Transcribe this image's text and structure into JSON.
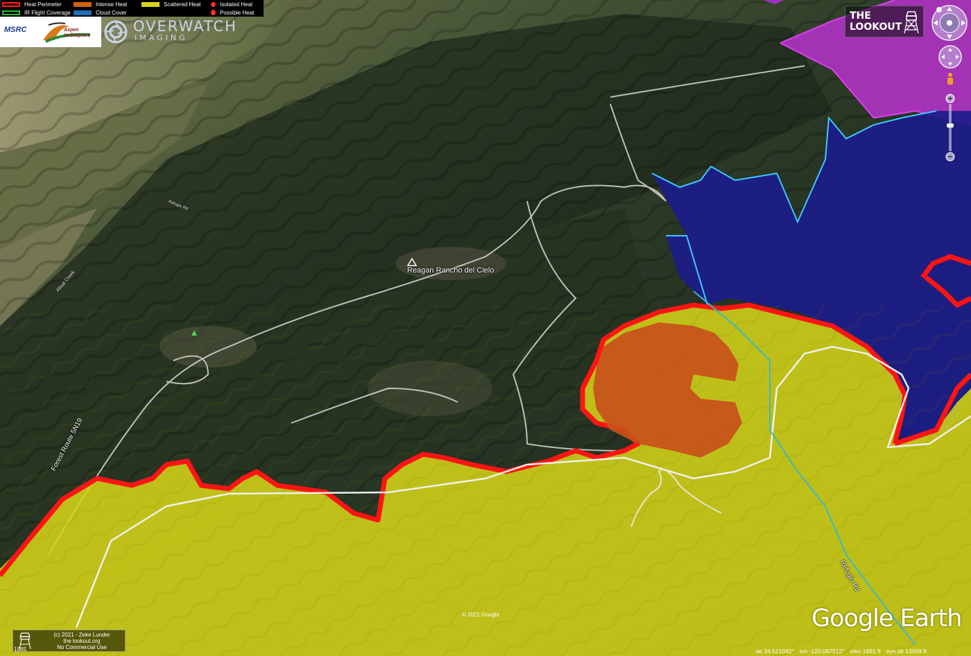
{
  "legend": {
    "items": [
      {
        "label": "Heat Perimeter",
        "kind": "outline",
        "color": "#ff1a1a"
      },
      {
        "label": "IR Flight Coverage",
        "kind": "outline",
        "color": "#1fbf3a"
      },
      {
        "label": "Intense Heat",
        "kind": "fill",
        "color": "#d4600f"
      },
      {
        "label": "Cloud Cover",
        "kind": "fill",
        "color": "#1d6fb8"
      },
      {
        "label": "Scattered Heat",
        "kind": "fill",
        "color": "#d4d41c"
      },
      {
        "label": "Isolated Heat",
        "kind": "dot",
        "color": "#ff2a2a"
      },
      {
        "label": "Possible Heat",
        "kind": "pin",
        "color": "#ff2a2a"
      }
    ]
  },
  "logos": {
    "msrc": "MSRC",
    "aspen": "Aspen Helicopters",
    "overwatch_title": "OVERWATCH",
    "overwatch_sub": "IMAGING"
  },
  "lookout_badge": {
    "line1": "THE",
    "line2": "LOOKOUT"
  },
  "map_labels": {
    "landmark": "Reagan Rancho del Cielo",
    "forest_route": "Forest Route 5N19",
    "refugio_rd": "Refugio Rd",
    "alisal_creek": "Alisal Creek",
    "refugio_small": "Refugio Rd"
  },
  "credit": {
    "line1": "(c) 2021 - Zeke Lunder",
    "line2": "the lookout.org",
    "line3": "No Commercial Use",
    "year": "1985"
  },
  "copyright": "© 2021 Google",
  "brand": "Google Earth",
  "status": {
    "lat": "lat  34.521042°",
    "lon": "lon -120.087512°",
    "elev": "elev 1891 ft",
    "eye": "eye alt 13958 ft"
  },
  "colors": {
    "scattered_heat": "#d4d41c",
    "intense_heat": "#c8501a",
    "perimeter": "#ff1010",
    "cloud_dark": "#1f1f8f",
    "cloud_edge": "#2ec8ff",
    "magenta_zone": "#b030c0",
    "ir_coverage_line": "#ffffff",
    "creek": "#3ab8c8"
  }
}
